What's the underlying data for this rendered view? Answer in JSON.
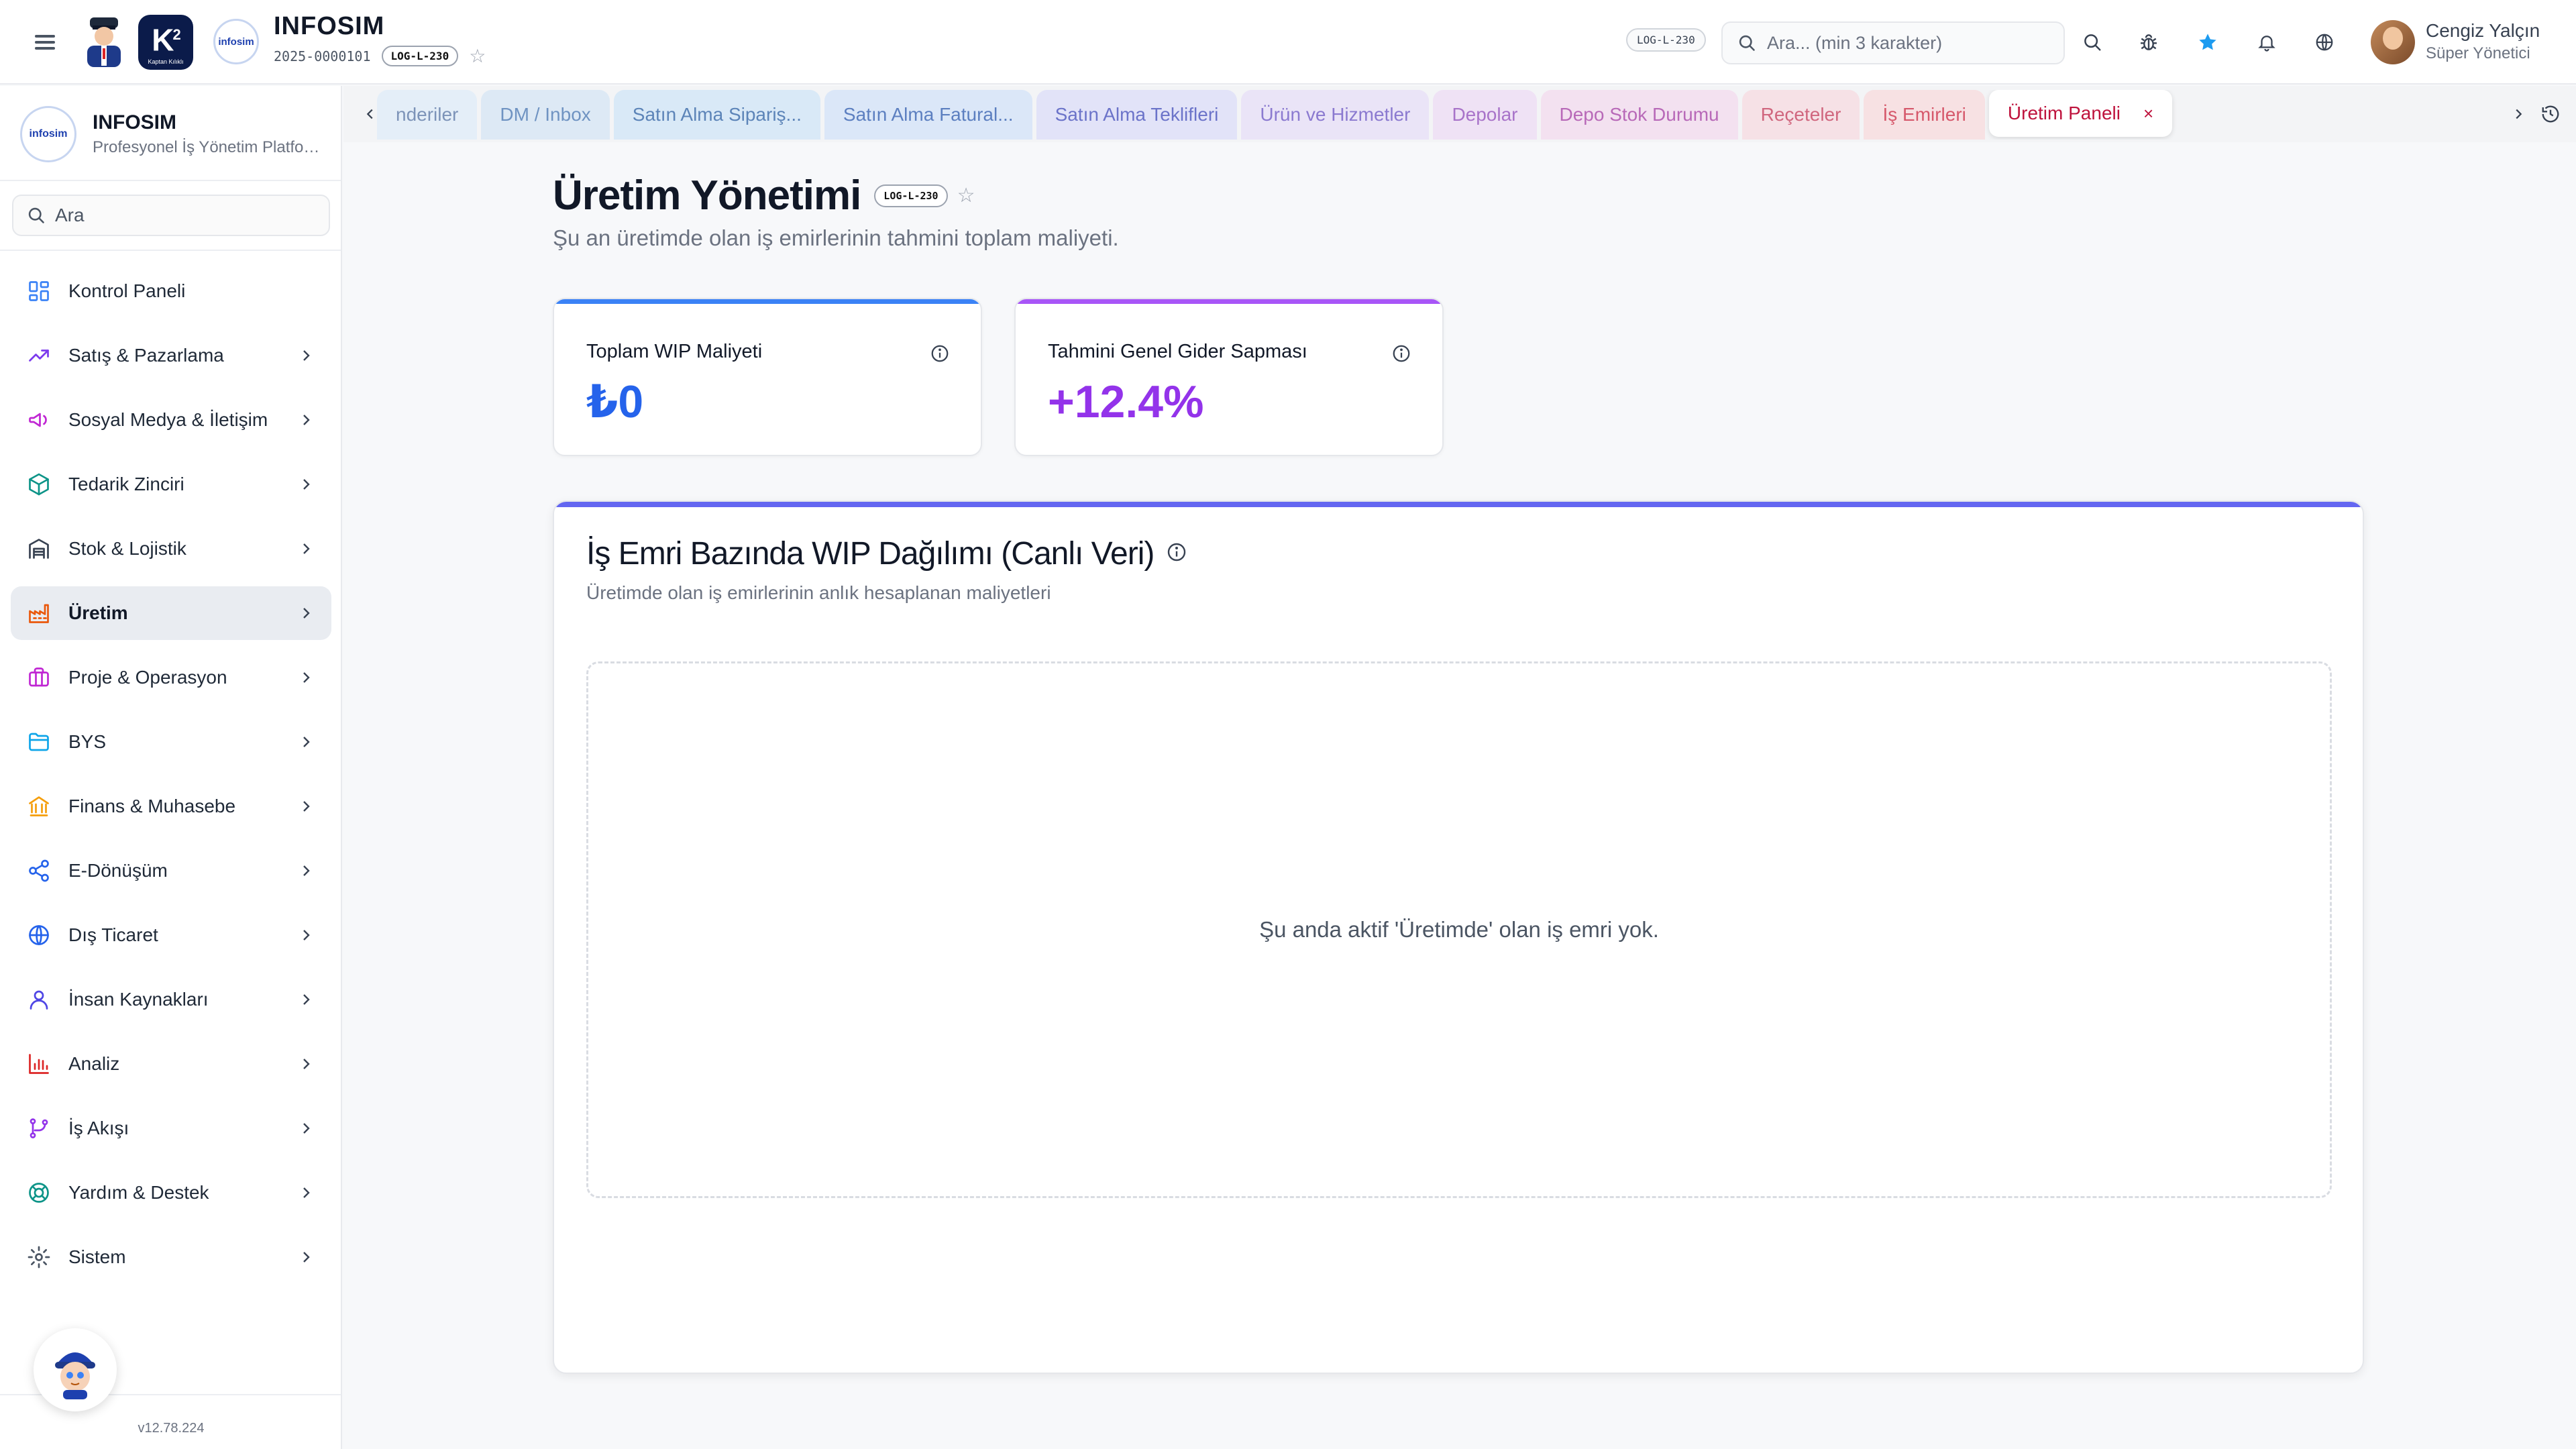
{
  "header": {
    "company_name": "INFOSIM",
    "company_code": "2025-0000101",
    "company_badge": "LOG-L-230",
    "logo_text": "infosim",
    "k2_text": "K",
    "k2_sup": "2",
    "k2_caption": "Kaptan Kılıklı",
    "page_code_badge": "LOG-L-230",
    "search_placeholder": "Ara... (min 3 karakter)",
    "user_name": "Cengiz Yalçın",
    "user_role": "Süper Yönetici",
    "accent_star_color": "#1d9bf0"
  },
  "sidebar": {
    "brand_title": "INFOSIM",
    "brand_subtitle": "Profesyonel İş Yönetim Platformu",
    "search_placeholder": "Ara",
    "items": [
      {
        "label": "Kontrol Paneli",
        "icon": "dashboard-icon",
        "color": "#3b82f6",
        "chevron": false
      },
      {
        "label": "Satış & Pazarlama",
        "icon": "trending-up-icon",
        "color": "#7c3aed",
        "chevron": true
      },
      {
        "label": "Sosyal Medya & İletişim",
        "icon": "megaphone-icon",
        "color": "#c026d3",
        "chevron": true
      },
      {
        "label": "Tedarik Zinciri",
        "icon": "box-icon",
        "color": "#0d9488",
        "chevron": true
      },
      {
        "label": "Stok & Lojistik",
        "icon": "warehouse-icon",
        "color": "#374151",
        "chevron": true
      },
      {
        "label": "Üretim",
        "icon": "factory-icon",
        "color": "#ea580c",
        "chevron": true,
        "active": true
      },
      {
        "label": "Proje & Operasyon",
        "icon": "briefcase-icon",
        "color": "#c026d3",
        "chevron": true
      },
      {
        "label": "BYS",
        "icon": "folder-icon",
        "color": "#0ea5e9",
        "chevron": true
      },
      {
        "label": "Finans & Muhasebe",
        "icon": "bank-icon",
        "color": "#f59e0b",
        "chevron": true
      },
      {
        "label": "E-Dönüşüm",
        "icon": "share-icon",
        "color": "#2563eb",
        "chevron": true
      },
      {
        "label": "Dış Ticaret",
        "icon": "globe-icon",
        "color": "#2563eb",
        "chevron": true
      },
      {
        "label": "İnsan Kaynakları",
        "icon": "user-icon",
        "color": "#4f46e5",
        "chevron": true
      },
      {
        "label": "Analiz",
        "icon": "bar-chart-icon",
        "color": "#dc2626",
        "chevron": true
      },
      {
        "label": "İş Akışı",
        "icon": "workflow-icon",
        "color": "#9333ea",
        "chevron": true
      },
      {
        "label": "Yardım & Destek",
        "icon": "lifebuoy-icon",
        "color": "#0d9488",
        "chevron": true
      },
      {
        "label": "Sistem",
        "icon": "gear-icon",
        "color": "#4b5563",
        "chevron": true
      }
    ],
    "version": "v12.78.224"
  },
  "tabs": [
    {
      "label": "nderiler",
      "bg": "#e4eef8",
      "color": "#7c93b8"
    },
    {
      "label": "DM / Inbox",
      "bg": "#dde9f5",
      "color": "#6f93c2"
    },
    {
      "label": "Satın Alma Sipariş...",
      "bg": "#d9e9f7",
      "color": "#5c84b8"
    },
    {
      "label": "Satın Alma Fatural...",
      "bg": "#dbe7f8",
      "color": "#5c7fc0"
    },
    {
      "label": "Satın Alma Teklifleri",
      "bg": "#e2e3f8",
      "color": "#6b73c9"
    },
    {
      "label": "Ürün ve Hizmetler",
      "bg": "#eae4f7",
      "color": "#8b7ad0"
    },
    {
      "label": "Depolar",
      "bg": "#efe2f5",
      "color": "#a873c9"
    },
    {
      "label": "Depo Stok Durumu",
      "bg": "#f3e1f0",
      "color": "#b869b8"
    },
    {
      "label": "Reçeteler",
      "bg": "#f6e1e6",
      "color": "#d0667e"
    },
    {
      "label": "İş Emirleri",
      "bg": "#f7e1e3",
      "color": "#d6586b"
    },
    {
      "label": "Üretim Paneli",
      "active": true,
      "close": "×"
    }
  ],
  "page": {
    "title": "Üretim Yönetimi",
    "badge": "LOG-L-230",
    "subtitle": "Şu an üretimde olan iş emirlerinin tahmini toplam maliyeti."
  },
  "kpis": [
    {
      "label": "Toplam WIP Maliyeti",
      "value": "₺0",
      "color": "#2563eb",
      "bar": "#3b82f6"
    },
    {
      "label": "Tahmini Genel Gider Sapması",
      "value": "+12.4%",
      "color": "#9333ea",
      "bar": "#a855f7"
    }
  ],
  "panel": {
    "title": "İş Emri Bazında WIP Dağılımı (Canlı Veri)",
    "subtitle": "Üretimde olan iş emirlerinin anlık hesaplanan maliyetleri",
    "empty_message": "Şu anda aktif 'Üretimde' olan iş emri yok.",
    "accent": "#6366f1"
  }
}
